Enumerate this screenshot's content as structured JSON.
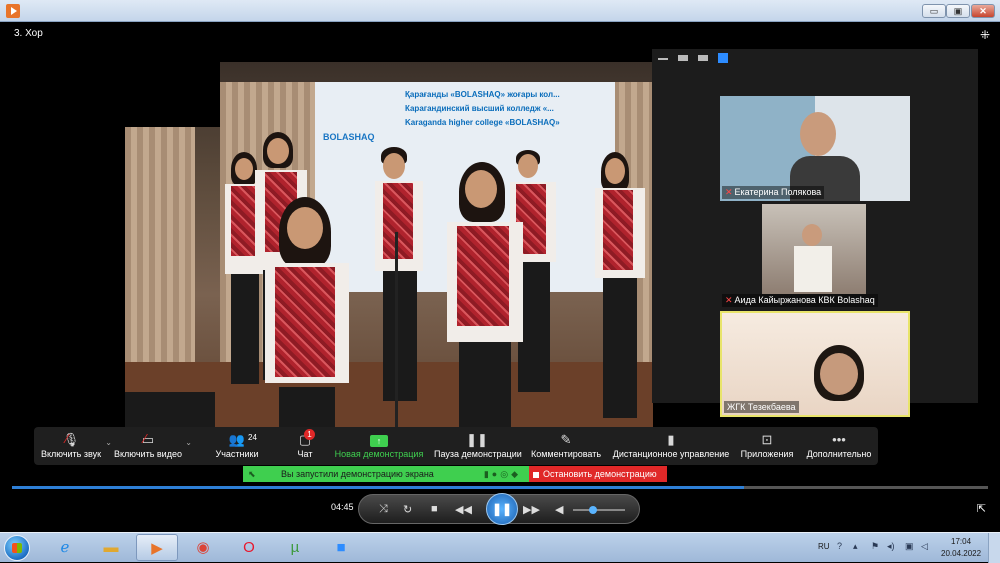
{
  "window": {
    "minimize": "▭",
    "maximize": "▣",
    "close": "✕"
  },
  "video": {
    "title": "3. Хор",
    "banner_lines": [
      "Қарағанды «BOLASHAQ» жоғары кол...",
      "Карагандинский высший колледж «...",
      "Karaganda higher college «BOLASHAQ»"
    ],
    "banner_logo": "BOLASHAQ"
  },
  "gallery": {
    "participants": [
      {
        "name": "Екатерина Полякова",
        "muted": true
      },
      {
        "name": "Аида Кайыржанова КВК Bolashaq",
        "muted": true
      },
      {
        "name": "ЖГК Тезекбаева",
        "muted": false
      }
    ]
  },
  "toolbar": {
    "unmute": "Включить звук",
    "start_video": "Включить видео",
    "participants": "Участники",
    "participants_count": "24",
    "chat": "Чат",
    "chat_badge": "1",
    "new_share": "Новая демонстрация",
    "pause_share": "Пауза демонстрации",
    "annotate": "Комментировать",
    "remote_control": "Дистанционное управление",
    "apps": "Приложения",
    "more": "Дополнительно"
  },
  "share_banner": {
    "text": "Вы запустили демонстрацию экрана",
    "stop": "Остановить демонстрацию"
  },
  "player": {
    "time": "04:45",
    "progress_fraction": 0.75,
    "volume_fraction": 0.3
  },
  "taskbar": {
    "lang": "RU",
    "time": "17:04",
    "date": "20.04.2022"
  },
  "colors": {
    "zoom_green": "#3fcf4f",
    "stop_red": "#e02828",
    "active_speaker": "#e8e46a"
  }
}
